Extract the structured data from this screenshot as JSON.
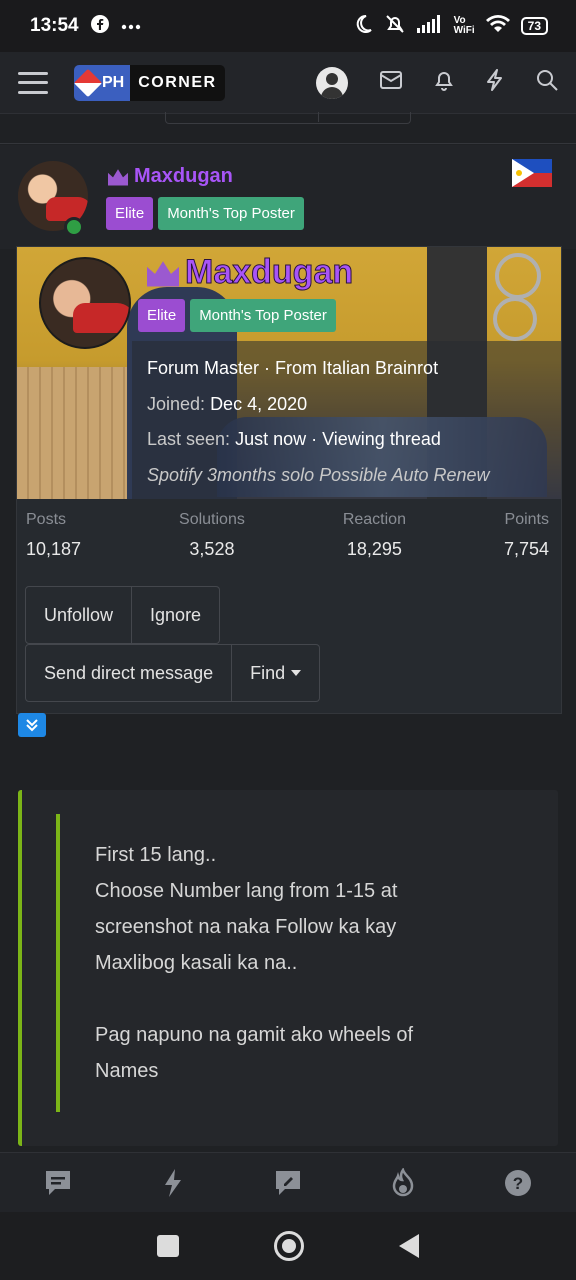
{
  "status_bar": {
    "time": "13:54",
    "notification_icons": [
      "facebook-icon",
      "more-icon"
    ],
    "system_icons": [
      "moon-icon",
      "mute-icon",
      "signal-icon",
      "vowifi-icon",
      "wifi-icon"
    ],
    "vowifi_label": "Vo\nWiFi",
    "battery": "73"
  },
  "header": {
    "logo_ph": "PH",
    "logo_corner": "CORNER",
    "icons": [
      "user-icon",
      "inbox-icon",
      "bell-icon",
      "lightning-icon",
      "search-icon"
    ]
  },
  "post": {
    "username": "Maxdugan",
    "badges": [
      "Elite",
      "Month's Top Poster"
    ],
    "flag": "philippines-flag"
  },
  "member_card": {
    "username": "Maxdugan",
    "badges": [
      "Elite",
      "Month's Top Poster"
    ],
    "title_line": "Forum Master · From Italian Brainrot",
    "joined_label": "Joined:",
    "joined_value": "Dec 4, 2020",
    "last_seen_label": "Last seen:",
    "last_seen_value": "Just now · Viewing thread",
    "custom_status": "Spotify 3months solo Possible Auto Renew",
    "stats": [
      {
        "label": "Posts",
        "value": "10,187"
      },
      {
        "label": "Solutions",
        "value": "3,528"
      },
      {
        "label": "Reaction",
        "value": "18,295"
      },
      {
        "label": "Points",
        "value": "7,754"
      }
    ],
    "buttons": {
      "unfollow": "Unfollow",
      "ignore": "Ignore",
      "send_dm": "Send direct message",
      "find": "Find"
    }
  },
  "quote": {
    "lines": [
      "First 15 lang..",
      "Choose Number lang from 1-15 at",
      "screenshot na naka Follow ka kay",
      "Maxlibog kasali ka na..",
      "",
      "Pag napuno na gamit ako wheels of",
      "Names"
    ]
  },
  "bottom_tabs": [
    "chat-icon",
    "lightning-icon",
    "edit-icon",
    "fire-icon",
    "help-icon"
  ],
  "colors": {
    "accent_purple": "#a855f7",
    "elite_badge": "#9b4dd1",
    "top_poster_badge": "#3fa57a",
    "quote_bar": "#7cb518",
    "logo_blue": "#3b5fbf"
  }
}
